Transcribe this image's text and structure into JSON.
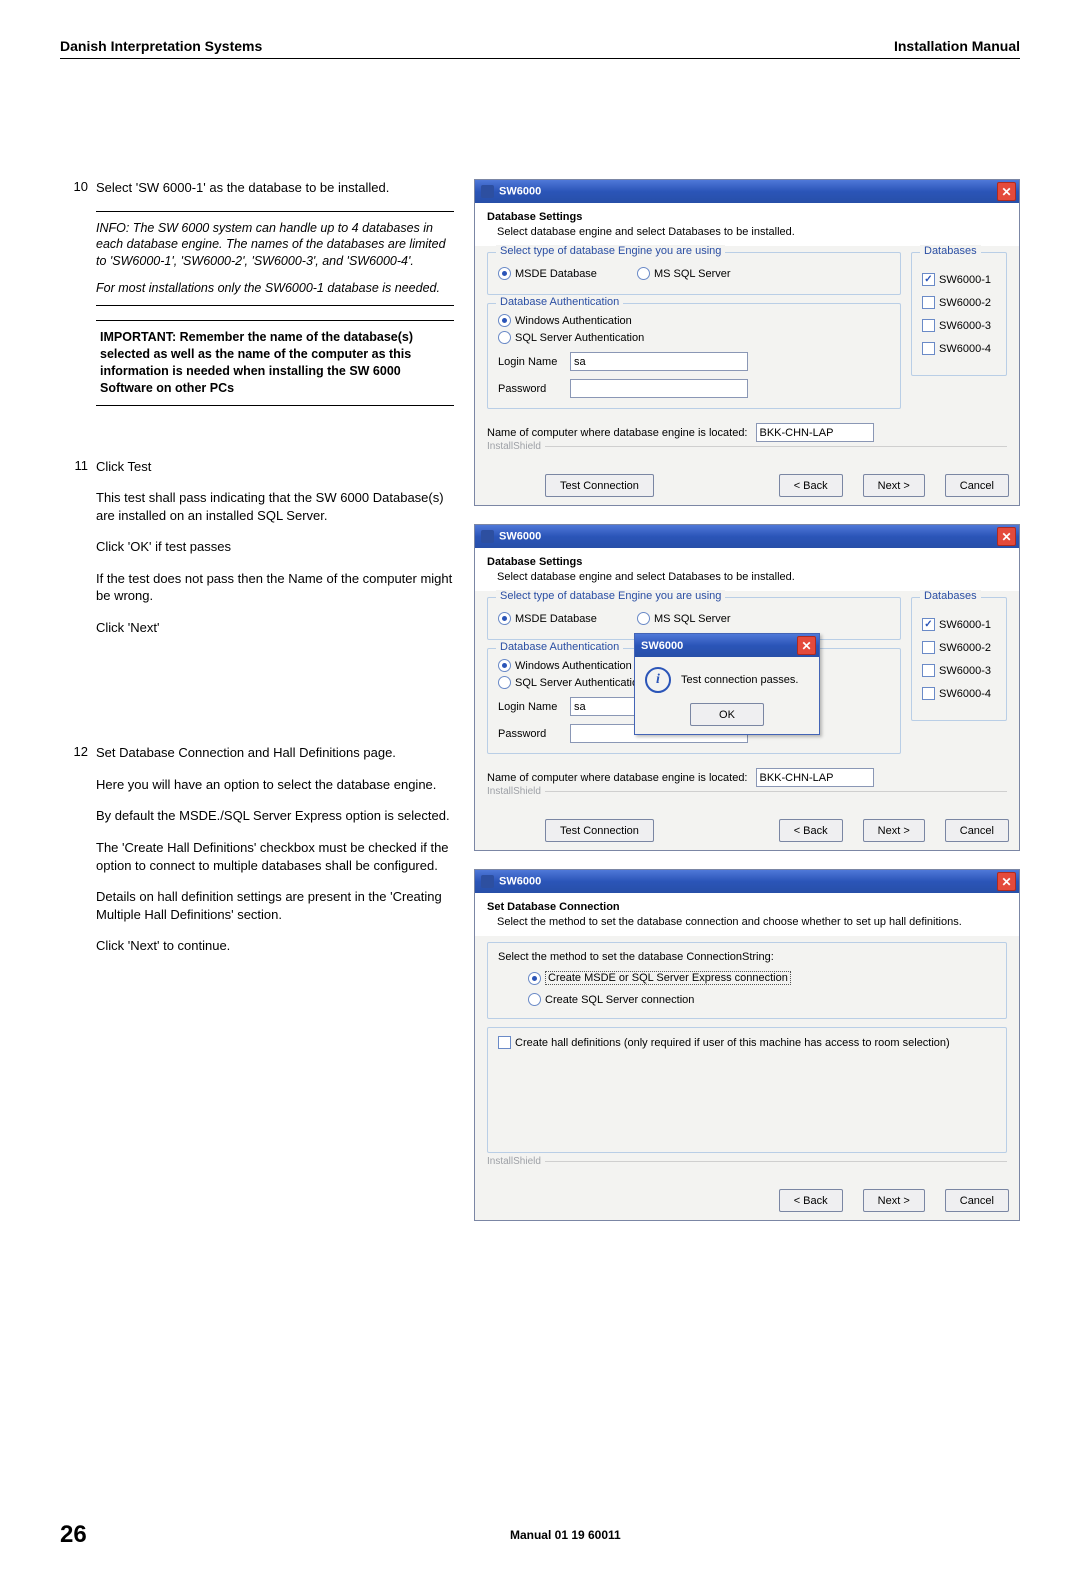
{
  "header": {
    "left": "Danish Interpretation Systems",
    "right": "Installation Manual"
  },
  "step10": {
    "num": "10",
    "text": "Select 'SW 6000-1' as the database to be installed.",
    "info1": "INFO:  The SW 6000 system can handle up to 4 databases in each database engine. The names of the databases are limited to 'SW6000-1', 'SW6000-2', 'SW6000-3', and 'SW6000-4'.",
    "info2": "For most installations only the SW6000-1 database is needed.",
    "important": "IMPORTANT: Remember the name of the database(s) selected as well as the name of the computer as this information is needed when installing the SW 6000 Software on other PCs"
  },
  "step11": {
    "num": "11",
    "p1": "Click Test",
    "p2": "This test shall pass indicating that the SW 6000 Database(s) are installed on an installed SQL Server.",
    "p3": "Click 'OK' if test passes",
    "p4": "If the test does not pass then the Name of the computer might be wrong.",
    "p5": "Click 'Next'"
  },
  "step12": {
    "num": "12",
    "p1": "Set Database Connection and Hall Definitions page.",
    "p2": "Here you will have an option to select the database engine.",
    "p3": "By default the MSDE./SQL Server Express option is selected.",
    "p4": "The 'Create Hall Definitions' checkbox must be checked if the option to connect to multiple databases shall be configured.",
    "p5": "Details on hall definition settings are present in the 'Creating Multiple Hall Definitions' section.",
    "p6": "Click 'Next' to continue."
  },
  "dlg": {
    "title": "SW6000",
    "heading": "Database Settings",
    "sub": "Select database engine and select Databases to be installed.",
    "engineLegend": "Select type of database Engine you are using",
    "engineOpt1": "MSDE Database",
    "engineOpt2": "MS SQL Server",
    "authLegend": "Database Authentication",
    "authOpt1": "Windows Authentication",
    "authOpt2": "SQL Server Authentication",
    "loginLabel": "Login Name",
    "loginValue": "sa",
    "pwdLabel": "Password",
    "dbLegend": "Databases",
    "db": [
      "SW6000-1",
      "SW6000-2",
      "SW6000-3",
      "SW6000-4"
    ],
    "computerLabel": "Name of computer where database engine is located:",
    "computerValue": "BKK-CHN-LAP",
    "install": "InstallShield",
    "btnTest": "Test Connection",
    "btnBack": "< Back",
    "btnNext": "Next >",
    "btnCancel": "Cancel"
  },
  "msg": {
    "title": "SW6000",
    "text": "Test connection passes.",
    "ok": "OK"
  },
  "dlg3": {
    "title": "SW6000",
    "heading": "Set Database Connection",
    "sub": "Select the method to set the database connection and choose whether to set up hall definitions.",
    "selLabel": "Select the method to set the database ConnectionString:",
    "opt1": "Create MSDE or SQL Server Express  connection",
    "opt2": "Create SQL Server connection",
    "chkLabel": "Create hall definitions (only required if user of this machine has access to room selection)",
    "install": "InstallShield",
    "btnBack": "< Back",
    "btnNext": "Next >",
    "btnCancel": "Cancel"
  },
  "footer": {
    "page": "26",
    "manual": "Manual 01 19 60011"
  }
}
